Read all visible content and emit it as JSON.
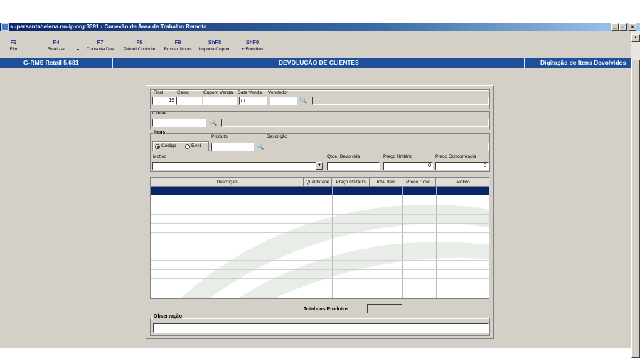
{
  "window": {
    "title": "supersantahelena.no-ip.org:3391 - Conexão de Área de Trabalho Remota",
    "min": "_",
    "max": "▫",
    "close": "x"
  },
  "toolbar": {
    "keys": [
      {
        "key": "F3",
        "label": "Fim"
      },
      {
        "key": "F4",
        "label": "Finalizar"
      },
      {
        "key": "F7",
        "label": "Consulta Dev"
      },
      {
        "key": "F8",
        "label": "Painel Controle"
      },
      {
        "key": "F9",
        "label": "Buscar Notas"
      },
      {
        "key": "ShF8",
        "label": "Importa Cupom"
      },
      {
        "key": "ShF9",
        "label": "+ Funções"
      }
    ]
  },
  "header": {
    "app": "G-RMS Retail 5.681",
    "title": "DEVOLUÇÃO DE CLIENTES",
    "subtitle": "Digitação de Itens Devolvidos"
  },
  "form": {
    "filial_label": "Filial",
    "filial_value": "19",
    "caixa_label": "Caixa",
    "cupom_label": "Cupom Venda",
    "data_label": "Data Venda",
    "data_value": "/ /",
    "vendedor_label": "Vendedor",
    "cliente_label": "Cliente",
    "itens_label": "Itens",
    "codigo_label": "Código",
    "ean_label": "EAN",
    "produto_label": "Produto",
    "descricao_label": "Descrição",
    "motivo_label": "Motivo",
    "qtde_label": "Qtde. Devolvida",
    "preco_unit_label": "Preço Unitário",
    "preco_unit_value": "0",
    "preco_conc_label": "Preço Concorrência",
    "preco_conc_value": "0",
    "total_label": "Total dos Produtos:",
    "obs_label": "Observação"
  },
  "grid": {
    "columns": [
      "Descrição",
      "Quantidade",
      "Preço Unitário",
      "Total Item",
      "Preço Conc.",
      "Motivo"
    ]
  },
  "colors": {
    "header_bar": "#1d4f9a",
    "selected_row": "#0a246a",
    "window_bg": "#d4d0c8"
  }
}
